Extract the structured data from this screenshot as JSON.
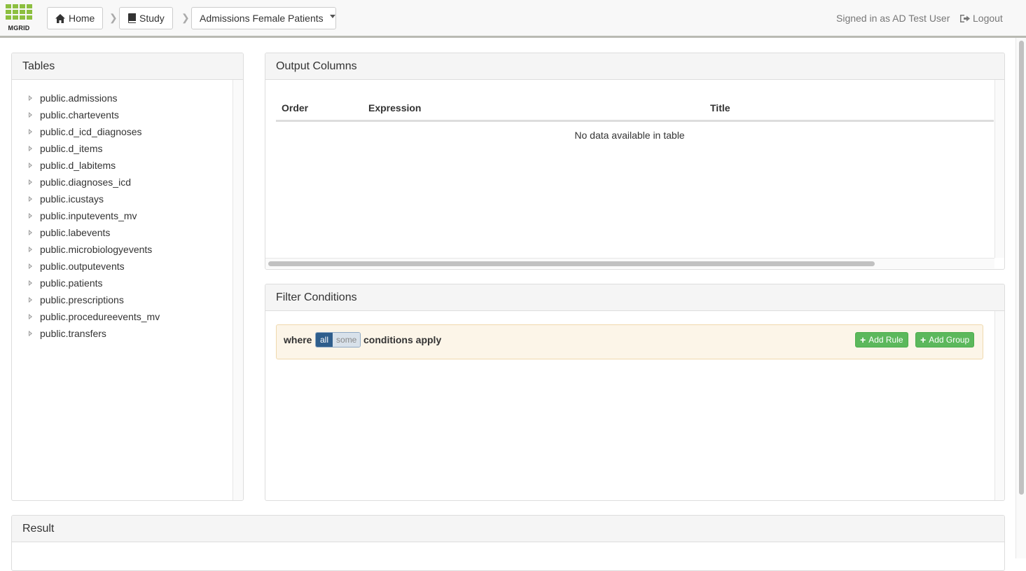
{
  "app": {
    "logo_text": "MGRID"
  },
  "breadcrumb": {
    "home_label": "Home",
    "study_label": "Study",
    "query_label": "Admissions Female Patients"
  },
  "user": {
    "signed_in_text": "Signed in as AD Test User",
    "logout_label": "Logout"
  },
  "tables_panel": {
    "title": "Tables",
    "items": [
      {
        "label": "public.admissions"
      },
      {
        "label": "public.chartevents"
      },
      {
        "label": "public.d_icd_diagnoses"
      },
      {
        "label": "public.d_items"
      },
      {
        "label": "public.d_labitems"
      },
      {
        "label": "public.diagnoses_icd"
      },
      {
        "label": "public.icustays"
      },
      {
        "label": "public.inputevents_mv"
      },
      {
        "label": "public.labevents"
      },
      {
        "label": "public.microbiologyevents"
      },
      {
        "label": "public.outputevents"
      },
      {
        "label": "public.patients"
      },
      {
        "label": "public.prescriptions"
      },
      {
        "label": "public.procedureevents_mv"
      },
      {
        "label": "public.transfers"
      }
    ]
  },
  "output_panel": {
    "title": "Output Columns",
    "columns": [
      "Order",
      "Expression",
      "Title"
    ],
    "empty_message": "No data available in table"
  },
  "filter_panel": {
    "title": "Filter Conditions",
    "where_label": "where",
    "toggle_all": "all",
    "toggle_some": "some",
    "conditions_label": "conditions apply",
    "add_rule_label": "Add Rule",
    "add_group_label": "Add Group"
  },
  "result_panel": {
    "title": "Result"
  },
  "colors": {
    "accent_green": "#5cb85c",
    "logo_green": "#8cbf3f",
    "toggle_active": "#2f5e8c",
    "rules_bg": "#fcf5e8"
  },
  "icons": [
    "home-icon",
    "book-icon",
    "logout-icon",
    "plus-icon",
    "chevron-right-icon",
    "tree-expand-icon"
  ]
}
